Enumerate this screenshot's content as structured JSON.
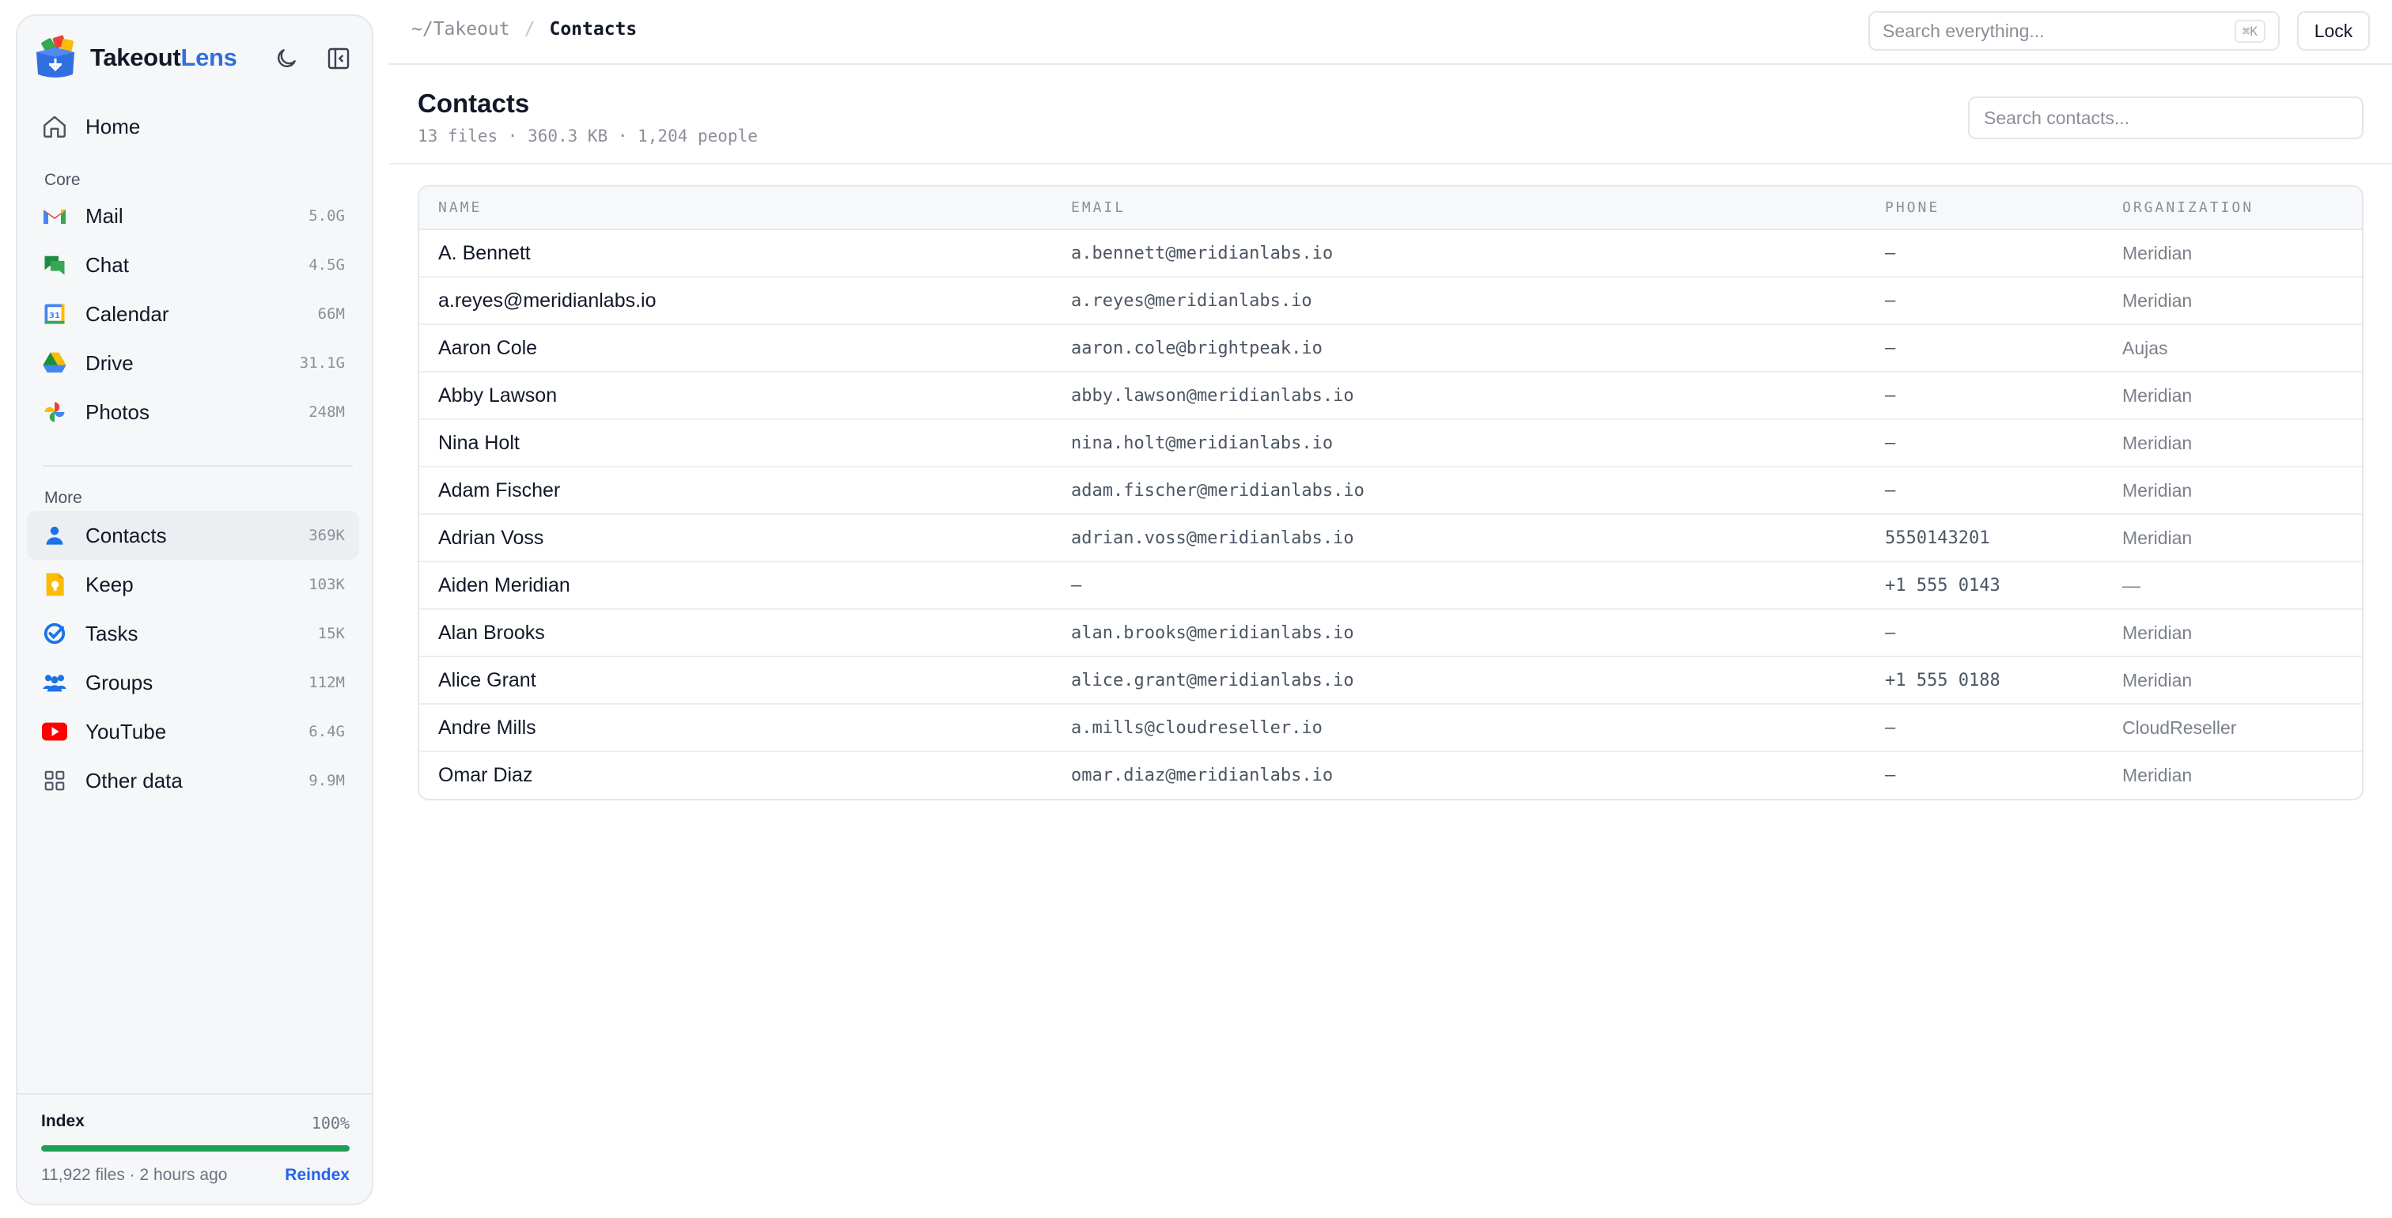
{
  "app": {
    "name_part1": "Takeout",
    "name_part2": "Lens",
    "accent_color": "#2f6fe0"
  },
  "sidebar": {
    "home_label": "Home",
    "core_title": "Core",
    "core_items": [
      {
        "label": "Mail",
        "size": "5.0G",
        "icon": "gmail-icon"
      },
      {
        "label": "Chat",
        "size": "4.5G",
        "icon": "chat-icon"
      },
      {
        "label": "Calendar",
        "size": "66M",
        "icon": "calendar-icon"
      },
      {
        "label": "Drive",
        "size": "31.1G",
        "icon": "drive-icon"
      },
      {
        "label": "Photos",
        "size": "248M",
        "icon": "photos-icon"
      }
    ],
    "more_title": "More",
    "more_items": [
      {
        "label": "Contacts",
        "size": "369K",
        "icon": "contacts-icon",
        "active": true
      },
      {
        "label": "Keep",
        "size": "103K",
        "icon": "keep-icon"
      },
      {
        "label": "Tasks",
        "size": "15K",
        "icon": "tasks-icon"
      },
      {
        "label": "Groups",
        "size": "112M",
        "icon": "groups-icon"
      },
      {
        "label": "YouTube",
        "size": "6.4G",
        "icon": "youtube-icon"
      },
      {
        "label": "Other data",
        "size": "9.9M",
        "icon": "grid-icon"
      }
    ],
    "index": {
      "title": "Index",
      "percent_label": "100%",
      "progress": 1.0,
      "meta": "11,922 files · 2 hours ago",
      "reindex_label": "Reindex",
      "bar_color": "#1f9d55"
    }
  },
  "topbar": {
    "breadcrumb_root": "~/Takeout",
    "breadcrumb_sep": "/",
    "breadcrumb_current": "Contacts",
    "search_placeholder": "Search everything...",
    "search_shortcut": "⌘K",
    "lock_label": "Lock"
  },
  "page": {
    "title": "Contacts",
    "subtitle": "13 files · 360.3 KB · 1,204 people",
    "search_placeholder": "Search contacts..."
  },
  "table": {
    "headers": [
      "NAME",
      "EMAIL",
      "PHONE",
      "ORGANIZATION"
    ],
    "rows": [
      {
        "name": "A. Bennett",
        "email": "a.bennett@meridianlabs.io",
        "phone": "—",
        "org": "Meridian"
      },
      {
        "name": "a.reyes@meridianlabs.io",
        "email": "a.reyes@meridianlabs.io",
        "phone": "—",
        "org": "Meridian"
      },
      {
        "name": "Aaron Cole",
        "email": "aaron.cole@brightpeak.io",
        "phone": "—",
        "org": "Aujas"
      },
      {
        "name": "Abby Lawson",
        "email": "abby.lawson@meridianlabs.io",
        "phone": "—",
        "org": "Meridian"
      },
      {
        "name": "Nina Holt",
        "email": "nina.holt@meridianlabs.io",
        "phone": "—",
        "org": "Meridian"
      },
      {
        "name": "Adam Fischer",
        "email": "adam.fischer@meridianlabs.io",
        "phone": "—",
        "org": "Meridian"
      },
      {
        "name": "Adrian Voss",
        "email": "adrian.voss@meridianlabs.io",
        "phone": "5550143201",
        "org": "Meridian"
      },
      {
        "name": "Aiden Meridian",
        "email": "—",
        "phone": "+1 555 0143",
        "org": "—"
      },
      {
        "name": "Alan Brooks",
        "email": "alan.brooks@meridianlabs.io",
        "phone": "—",
        "org": "Meridian"
      },
      {
        "name": "Alice Grant",
        "email": "alice.grant@meridianlabs.io",
        "phone": "+1 555 0188",
        "org": "Meridian"
      },
      {
        "name": "Andre Mills",
        "email": "a.mills@cloudreseller.io",
        "phone": "—",
        "org": "CloudReseller"
      },
      {
        "name": "Omar Diaz",
        "email": "omar.diaz@meridianlabs.io",
        "phone": "—",
        "org": "Meridian"
      }
    ]
  }
}
